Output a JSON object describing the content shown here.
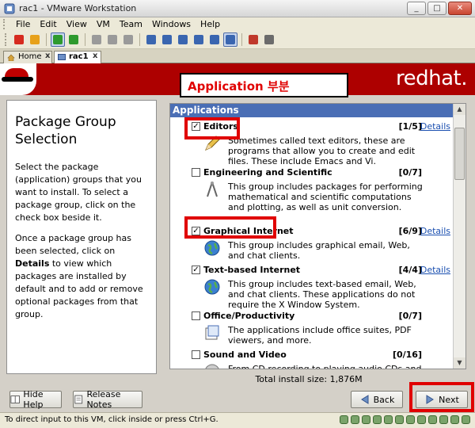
{
  "window": {
    "title": "rac1 - VMware Workstation"
  },
  "window_controls": {
    "minimize": "_",
    "maximize": "□",
    "close": "✕"
  },
  "menu": [
    "File",
    "Edit",
    "View",
    "VM",
    "Team",
    "Windows",
    "Help"
  ],
  "toolbar": {
    "icons": [
      {
        "name": "power-off-icon",
        "color": "#d62b1f"
      },
      {
        "name": "suspend-icon",
        "color": "#e7a11a"
      },
      {
        "name": "power-on-icon",
        "color": "#2e9a2e",
        "active": true
      },
      {
        "name": "reset-icon",
        "color": "#2e9a2e"
      },
      {
        "name": "snapshot-icon",
        "color": "#9a9a9a"
      },
      {
        "name": "revert-snapshot-icon",
        "color": "#9a9a9a"
      },
      {
        "name": "snapshot-manager-icon",
        "color": "#9a9a9a"
      },
      {
        "name": "show-console-icon",
        "color": "#3a66b0"
      },
      {
        "name": "full-screen-icon",
        "color": "#3a66b0"
      },
      {
        "name": "quick-switch-icon",
        "color": "#3a66b0"
      },
      {
        "name": "summary-icon",
        "color": "#3a66b0"
      },
      {
        "name": "appliance-view-icon",
        "color": "#3a66b0"
      },
      {
        "name": "console-view-icon",
        "color": "#3a66b0",
        "active": true
      },
      {
        "name": "team-icon",
        "color": "#c0392b"
      },
      {
        "name": "settings-icon",
        "color": "#6b6b6b"
      }
    ]
  },
  "tabs": [
    {
      "label": "Home",
      "active": false
    },
    {
      "label": "rac1",
      "active": true
    }
  ],
  "tab_close": "x",
  "vm": {
    "brand": "redhat.",
    "callout": "Application 부분",
    "left": {
      "title": "Package Group Selection",
      "para1": "Select the package (application) groups that you want to install. To select a package group, click on the check box beside it.",
      "para2_pre": "Once a package group has been selected, click on ",
      "para2_bold": "Details",
      "para2_post": " to view which packages are installed by default and to add or remove optional packages from that group."
    },
    "apps_header": "Applications",
    "groups": [
      {
        "name": "Editors",
        "checked": true,
        "count": "[1/5]",
        "details": "Details",
        "desc": "Sometimes called text editors, these are programs that allow you to create and edit files. These include Emacs and Vi.",
        "icon": "pencil-icon"
      },
      {
        "name": "Engineering and Scientific",
        "checked": false,
        "count": "[0/7]",
        "details": "",
        "desc": "This group includes packages for performing mathematical and scientific computations and plotting, as well as unit conversion.",
        "icon": "compass-icon"
      },
      {
        "name": "Graphical Internet",
        "checked": true,
        "count": "[6/9]",
        "details": "Details",
        "desc": "This group includes graphical email, Web, and chat clients.",
        "icon": "globe-icon"
      },
      {
        "name": "Text-based Internet",
        "checked": true,
        "count": "[4/4]",
        "details": "Details",
        "desc": "This group includes text-based email, Web, and chat clients. These applications do not require the X Window System.",
        "icon": "globe-icon"
      },
      {
        "name": "Office/Productivity",
        "checked": false,
        "count": "[0/7]",
        "details": "",
        "desc": "The applications include office suites, PDF viewers, and more.",
        "icon": "office-icon"
      },
      {
        "name": "Sound and Video",
        "checked": false,
        "count": "[0/16]",
        "details": "",
        "desc": "From CD recording to playing audio CDs and multimedia",
        "icon": "media-icon"
      }
    ],
    "install_size": "Total install size: 1,876M",
    "buttons": {
      "hide_help": "Hide Help",
      "release_notes": "Release Notes",
      "back": "Back",
      "next": "Next"
    }
  },
  "status": {
    "text": "To direct input to this VM, click inside or press Ctrl+G."
  },
  "colors": {
    "highlight": "#e00000",
    "redhat": "#ad0000",
    "header": "#4a6eb5"
  }
}
